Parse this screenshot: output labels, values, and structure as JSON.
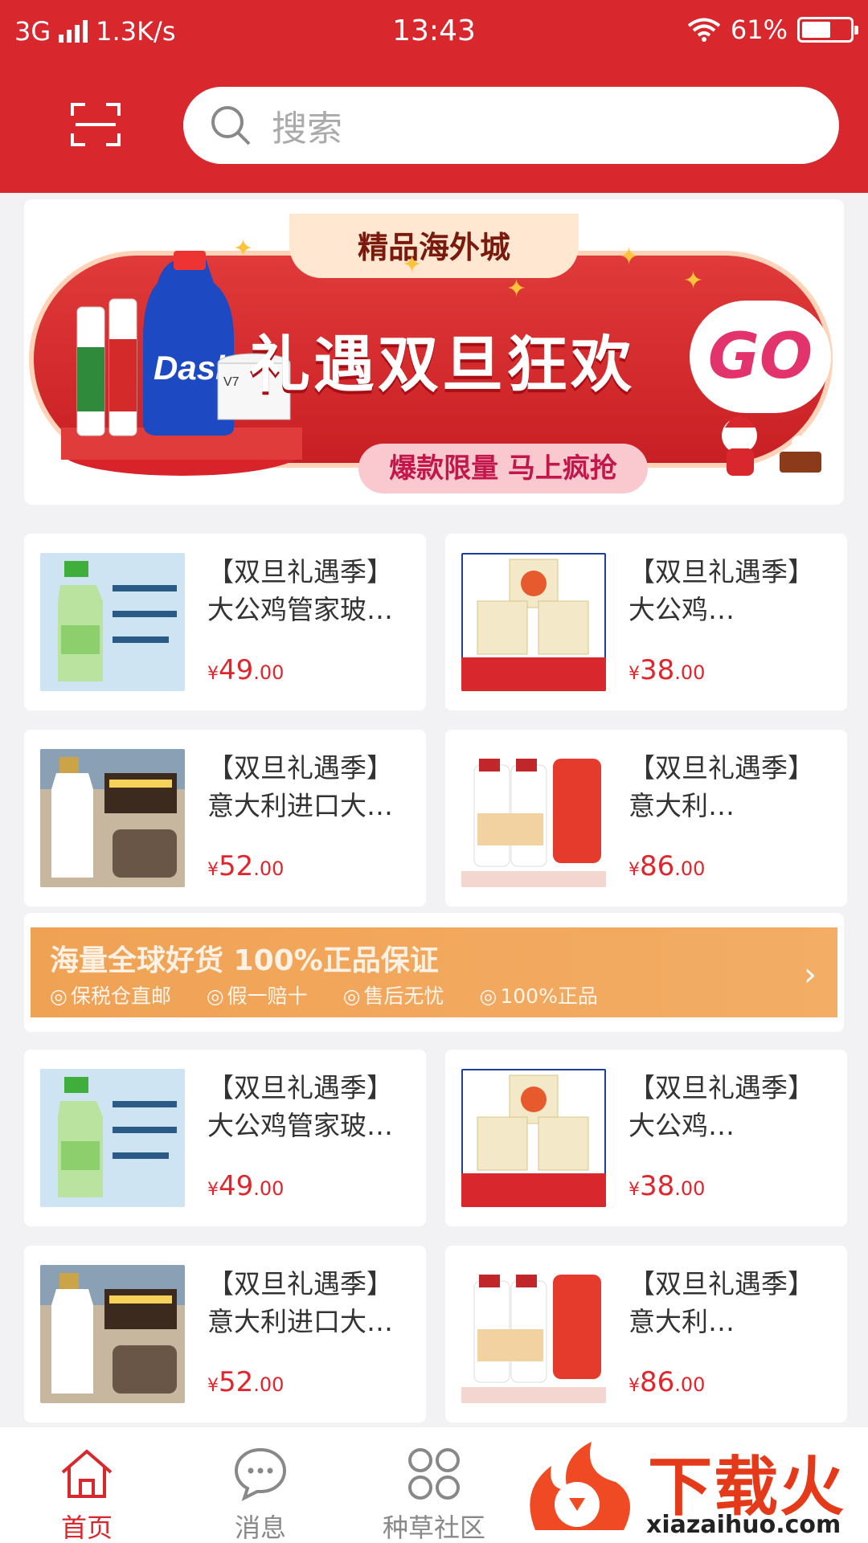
{
  "status_bar": {
    "network": "3G",
    "speed": "1.3K/s",
    "time": "13:43",
    "battery": "61%",
    "battery_level": 0.61
  },
  "search": {
    "placeholder": "搜索"
  },
  "banner": {
    "tag": "精品海外城",
    "title": "礼遇双旦狂欢",
    "cta": "GO",
    "subtitle": "爆款限量 马上疯抢"
  },
  "products": [
    {
      "title": "【双旦礼遇季】大公鸡管家玻…",
      "currency": "¥",
      "price_int": "49",
      "price_dec": ".00",
      "img": "spray"
    },
    {
      "title": "【双旦礼遇季】大公鸡…",
      "currency": "¥",
      "price_int": "38",
      "price_dec": ".00",
      "img": "soap"
    },
    {
      "title": "【双旦礼遇季】意大利进口大…",
      "currency": "¥",
      "price_int": "52",
      "price_dec": ".00",
      "img": "wool"
    },
    {
      "title": "【双旦礼遇季】意大利…",
      "currency": "¥",
      "price_int": "86",
      "price_dec": ".00",
      "img": "detergent"
    },
    {
      "title": "【双旦礼遇季】大公鸡管家玻…",
      "currency": "¥",
      "price_int": "49",
      "price_dec": ".00",
      "img": "spray"
    },
    {
      "title": "【双旦礼遇季】大公鸡…",
      "currency": "¥",
      "price_int": "38",
      "price_dec": ".00",
      "img": "soap"
    },
    {
      "title": "【双旦礼遇季】意大利进口大…",
      "currency": "¥",
      "price_int": "52",
      "price_dec": ".00",
      "img": "wool"
    },
    {
      "title": "【双旦礼遇季】意大利…",
      "currency": "¥",
      "price_int": "86",
      "price_dec": ".00",
      "img": "detergent"
    }
  ],
  "guarantee": {
    "headline": "海量全球好货 100%正品保证",
    "items": [
      "保税仓直邮",
      "假一赔十",
      "售后无忧",
      "100%正品"
    ]
  },
  "nav": {
    "home": "首页",
    "messages": "消息",
    "community": "种草社区"
  },
  "watermark": {
    "title": "下载火",
    "url": "xiazaihuo.com"
  },
  "colors": {
    "brand": "#d8282d",
    "price": "#e0262c",
    "guarantee": "#f0a254"
  }
}
